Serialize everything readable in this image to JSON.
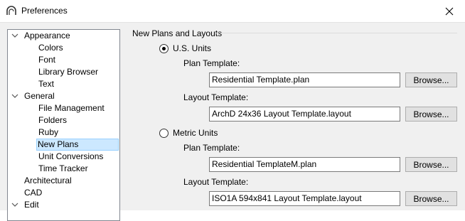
{
  "window": {
    "title": "Preferences"
  },
  "tree": [
    {
      "label": "Appearance",
      "expanded": true,
      "level": 0
    },
    {
      "label": "Colors",
      "level": 1
    },
    {
      "label": "Font",
      "level": 1
    },
    {
      "label": "Library Browser",
      "level": 1
    },
    {
      "label": "Text",
      "level": 1
    },
    {
      "label": "General",
      "expanded": true,
      "level": 0
    },
    {
      "label": "File Management",
      "level": 1
    },
    {
      "label": "Folders",
      "level": 1
    },
    {
      "label": "Ruby",
      "level": 1
    },
    {
      "label": "New Plans",
      "level": 1,
      "selected": true
    },
    {
      "label": "Unit Conversions",
      "level": 1
    },
    {
      "label": "Time Tracker",
      "level": 1
    },
    {
      "label": "Architectural",
      "level": 0
    },
    {
      "label": "CAD",
      "level": 0
    },
    {
      "label": "Edit",
      "expanded": true,
      "level": 0
    }
  ],
  "panel": {
    "group_title": "New Plans and Layouts",
    "us_units": {
      "label": "U.S. Units",
      "checked": true,
      "plan_label": "Plan Template:",
      "plan_value": "Residential Template.plan",
      "layout_label": "Layout Template:",
      "layout_value": "ArchD 24x36 Layout Template.layout"
    },
    "metric_units": {
      "label": "Metric Units",
      "checked": false,
      "plan_label": "Plan Template:",
      "plan_value": "Residential TemplateM.plan",
      "layout_label": "Layout Template:",
      "layout_value": "ISO1A 594x841 Layout Template.layout"
    },
    "browse_label": "Browse..."
  },
  "colors": {
    "selection_bg": "#cce8ff",
    "selection_border": "#99d1ff",
    "client_bg": "#f0f0f0"
  }
}
